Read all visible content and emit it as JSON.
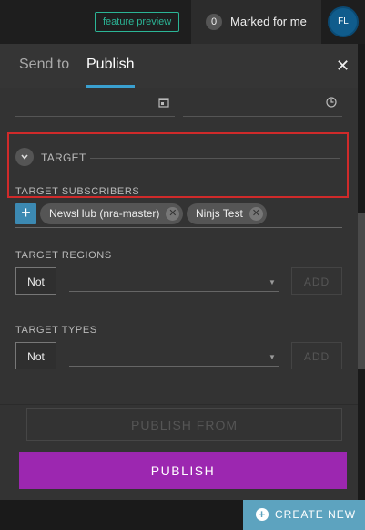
{
  "topbar": {
    "feature_preview": "feature preview",
    "marked_count": "0",
    "marked_label": "Marked for me",
    "avatar_initials": "FL"
  },
  "panel": {
    "tabs": [
      {
        "label": "Send to",
        "active": false
      },
      {
        "label": "Publish",
        "active": true
      }
    ],
    "close_glyph": "✕",
    "target_label": "TARGET",
    "subscribers": {
      "label": "TARGET SUBSCRIBERS",
      "add_glyph": "+",
      "chips": [
        {
          "label": "NewsHub (nra-master)"
        },
        {
          "label": "Ninjs Test"
        }
      ]
    },
    "regions": {
      "label": "TARGET REGIONS",
      "not_label": "Not",
      "add_label": "ADD"
    },
    "types": {
      "label": "TARGET TYPES",
      "not_label": "Not",
      "add_label": "ADD"
    },
    "publish_from_label": "PUBLISH FROM",
    "publish_label": "PUBLISH"
  },
  "create_new_label": "CREATE NEW",
  "colors": {
    "accent_purple": "#9c27b0",
    "highlight_red": "#d02a2a",
    "tab_underline": "#3aa0d0",
    "create_new_bg": "#5da3bf"
  }
}
